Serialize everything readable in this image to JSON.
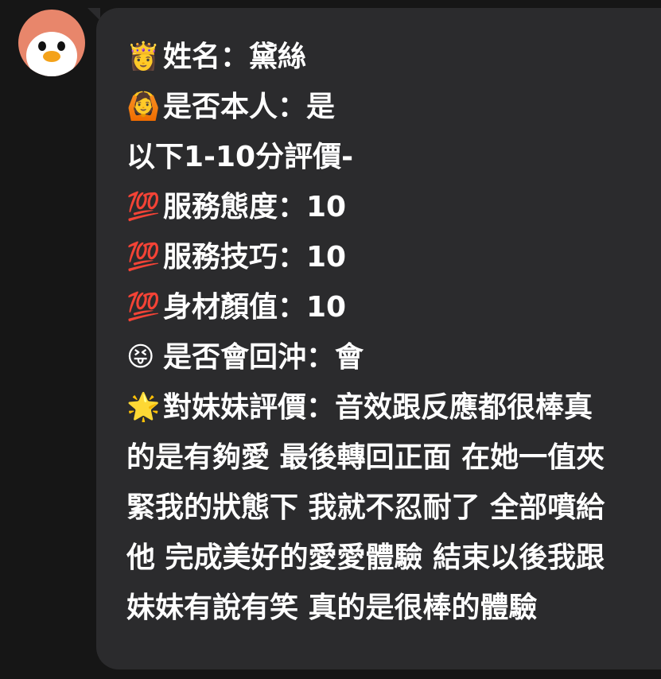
{
  "avatar": {
    "icon": "penguin-icon"
  },
  "message": {
    "lines": [
      {
        "emoji": "👸",
        "text": "姓名：黛絲"
      },
      {
        "emoji": "🙆",
        "text": "是否本人：是"
      },
      {
        "emoji": "",
        "text": "以下1-10分評價-"
      },
      {
        "emoji": "💯",
        "text": "服務態度：10"
      },
      {
        "emoji": "💯",
        "text": "服務技巧：10"
      },
      {
        "emoji": "💯",
        "text": "身材顏值：10"
      },
      {
        "emoji": "😝",
        "text": "是否會回沖：會"
      }
    ],
    "review": {
      "emoji": "🌟",
      "text": "對妹妹評價：音效跟反應都很棒真的是有夠愛 最後轉回正面 在她一值夾緊我的狀態下 我就不忍耐了 全部噴給他 完成美好的愛愛體驗 結束以後我跟妹妹有說有笑 真的是很棒的體驗"
    }
  },
  "colors": {
    "background": "#161616",
    "bubble": "#2b2b2d",
    "text": "#ffffff",
    "avatar_bg": "#e8866b"
  }
}
